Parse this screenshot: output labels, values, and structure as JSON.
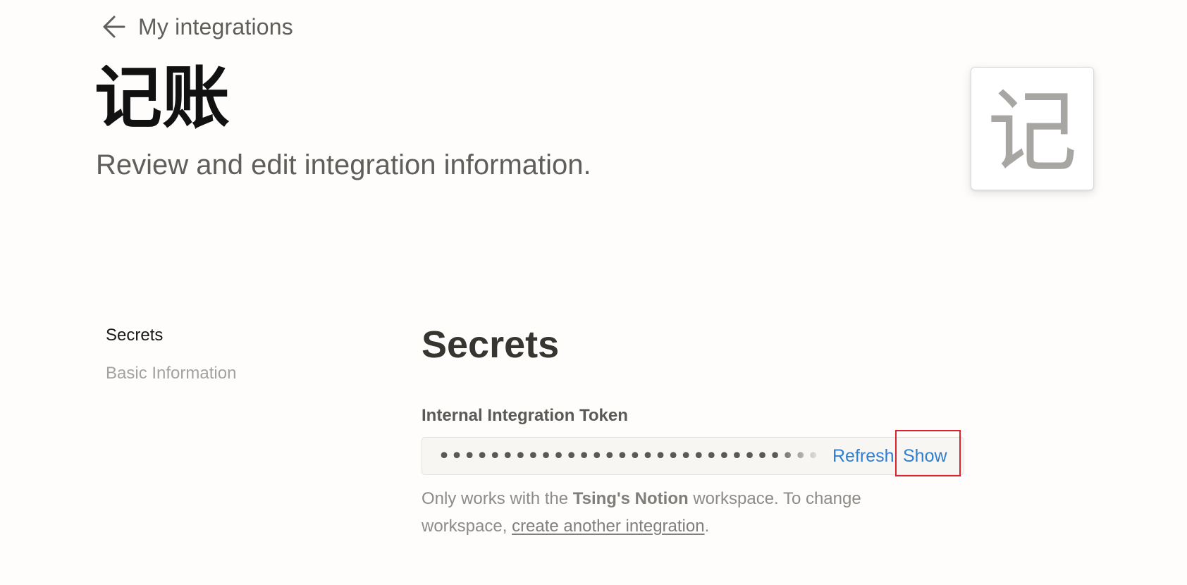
{
  "nav": {
    "back_label": "My integrations"
  },
  "integration": {
    "name": "记账",
    "subtitle": "Review and edit integration information.",
    "icon_glyph": "记"
  },
  "sidebar": {
    "items": [
      {
        "label": "Secrets",
        "active": true
      },
      {
        "label": "Basic Information",
        "active": false
      }
    ]
  },
  "secrets": {
    "title": "Secrets",
    "token_label": "Internal Integration Token",
    "token_masked": "••••••••••••••••••••••••••••••••••••",
    "refresh_label": "Refresh",
    "show_label": "Show",
    "help": {
      "prefix": "Only works with the ",
      "workspace": "Tsing's Notion",
      "middle": " workspace. To change workspace, ",
      "link": "create another integration",
      "suffix": "."
    }
  },
  "colors": {
    "accent_link": "#2e7fd2",
    "highlight": "#d9232e",
    "background": "#fefdfc"
  },
  "icons": {
    "back": "arrow-left-icon"
  }
}
